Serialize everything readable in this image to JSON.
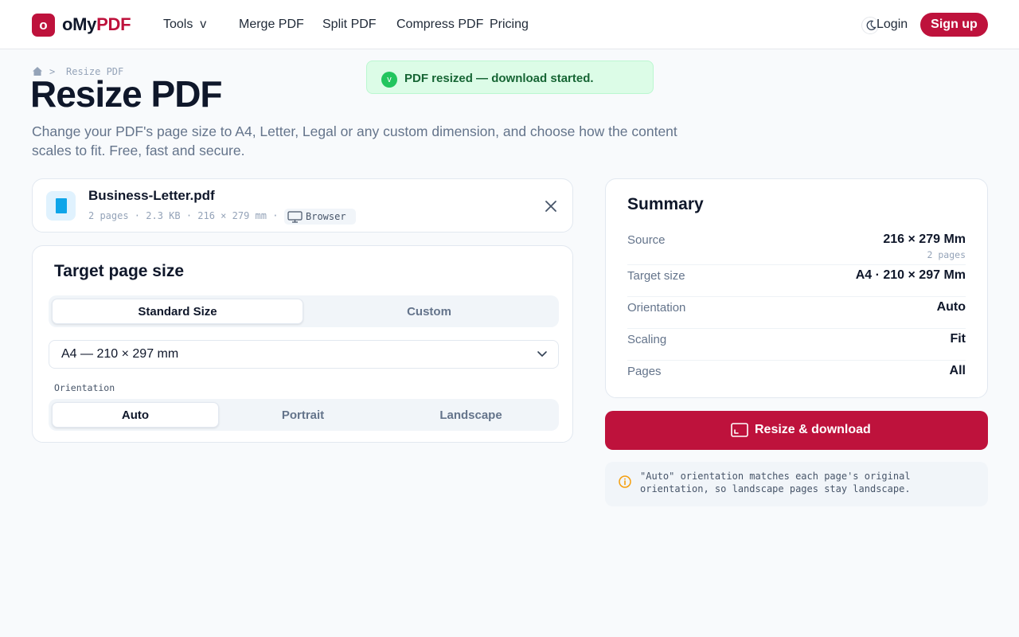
{
  "brand": {
    "logo_letter": "o",
    "name_prefix": "oMy",
    "name_accent": "PDF",
    "accent": "#be123c"
  },
  "nav": {
    "tools": "Tools  v",
    "merge": "Merge PDF",
    "split": "Split PDF",
    "compress": "Compress PDF",
    "pricing": "Pricing",
    "login": "Login",
    "signup": "Sign up"
  },
  "breadcrumb": {
    "separator": ">",
    "current": "Resize PDF"
  },
  "page": {
    "title": "Resize PDF",
    "subtitle": "Change your PDF's page size to A4, Letter, Legal or any custom dimension, and choose how the content scales to fit. Free, fast and secure."
  },
  "toast": {
    "icon": "v",
    "message": "PDF resized — download started."
  },
  "file": {
    "name": "Business-Letter.pdf",
    "meta": "2 pages · 2.3 KB · 216 × 279 mm ·",
    "badge": "Browser"
  },
  "target_size": {
    "title": "Target page size",
    "tabs": [
      "Standard Size",
      "Custom"
    ],
    "selected_size": "A4 — 210 × 297 mm",
    "orientation_label": "Orientation",
    "orientations": [
      "Auto",
      "Portrait",
      "Landscape"
    ]
  },
  "summary": {
    "title": "Summary",
    "source_label": "Source",
    "source_value": "216 × 279 Mm",
    "source_sub": "2 pages",
    "target_label": "Target size",
    "target_value": "A4 · 210 × 297 Mm",
    "orientation_label": "Orientation",
    "orientation_value": "Auto",
    "scaling_label": "Scaling",
    "scaling_value": "Fit",
    "pages_label": "Pages",
    "pages_value": "All"
  },
  "cta": {
    "label": "Resize & download"
  },
  "note": {
    "text": "\"Auto\" orientation matches each page's original orientation, so landscape pages stay landscape."
  }
}
